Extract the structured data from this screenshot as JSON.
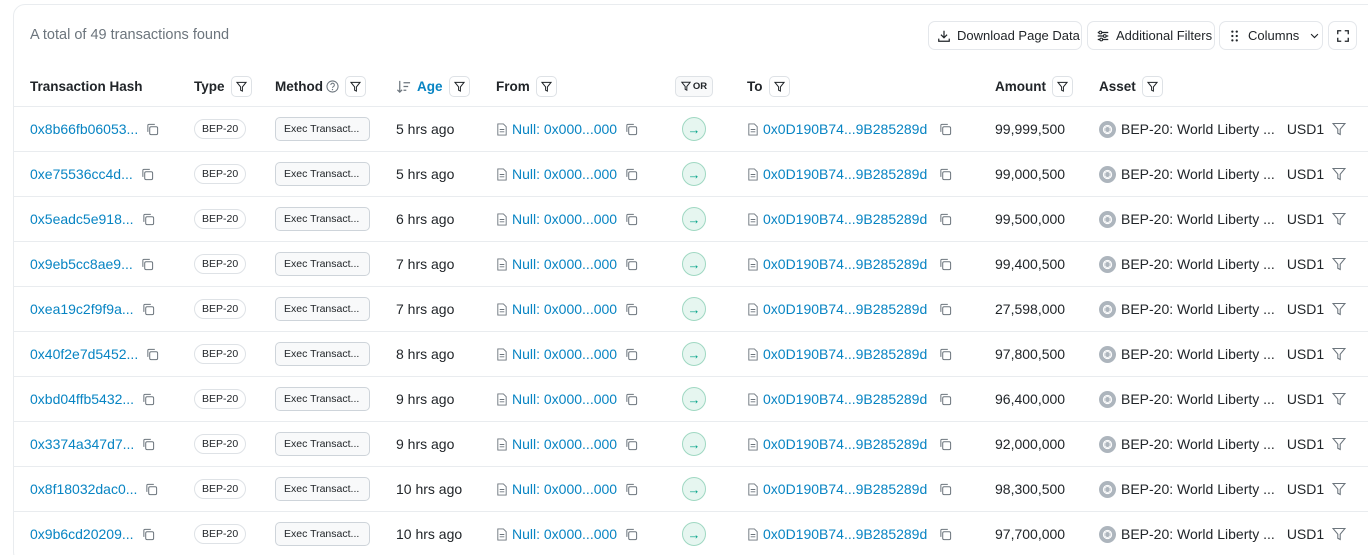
{
  "summary": {
    "total_text": "A total of 49 transactions found"
  },
  "toolbar": {
    "download_label": "Download Page Data",
    "filters_label": "Additional Filters",
    "columns_label": "Columns"
  },
  "columns": {
    "hash": "Transaction Hash",
    "type": "Type",
    "method": "Method",
    "age": "Age",
    "from": "From",
    "or": "OR",
    "to": "To",
    "amount": "Amount",
    "asset": "Asset"
  },
  "transactions": [
    {
      "hash": "0x8b66fb06053...",
      "type": "BEP-20",
      "method": "Exec Transact...",
      "age": "5 hrs ago",
      "from": "Null: 0x000...000",
      "to": "0x0D190B74...9B285289d",
      "amount": "99,999,500",
      "asset": "BEP-20: World Liberty ...",
      "symbol": "USD1"
    },
    {
      "hash": "0xe75536cc4d...",
      "type": "BEP-20",
      "method": "Exec Transact...",
      "age": "5 hrs ago",
      "from": "Null: 0x000...000",
      "to": "0x0D190B74...9B285289d",
      "amount": "99,000,500",
      "asset": "BEP-20: World Liberty ...",
      "symbol": "USD1"
    },
    {
      "hash": "0x5eadc5e918...",
      "type": "BEP-20",
      "method": "Exec Transact...",
      "age": "6 hrs ago",
      "from": "Null: 0x000...000",
      "to": "0x0D190B74...9B285289d",
      "amount": "99,500,000",
      "asset": "BEP-20: World Liberty ...",
      "symbol": "USD1"
    },
    {
      "hash": "0x9eb5cc8ae9...",
      "type": "BEP-20",
      "method": "Exec Transact...",
      "age": "7 hrs ago",
      "from": "Null: 0x000...000",
      "to": "0x0D190B74...9B285289d",
      "amount": "99,400,500",
      "asset": "BEP-20: World Liberty ...",
      "symbol": "USD1"
    },
    {
      "hash": "0xea19c2f9f9a...",
      "type": "BEP-20",
      "method": "Exec Transact...",
      "age": "7 hrs ago",
      "from": "Null: 0x000...000",
      "to": "0x0D190B74...9B285289d",
      "amount": "27,598,000",
      "asset": "BEP-20: World Liberty ...",
      "symbol": "USD1"
    },
    {
      "hash": "0x40f2e7d5452...",
      "type": "BEP-20",
      "method": "Exec Transact...",
      "age": "8 hrs ago",
      "from": "Null: 0x000...000",
      "to": "0x0D190B74...9B285289d",
      "amount": "97,800,500",
      "asset": "BEP-20: World Liberty ...",
      "symbol": "USD1"
    },
    {
      "hash": "0xbd04ffb5432...",
      "type": "BEP-20",
      "method": "Exec Transact...",
      "age": "9 hrs ago",
      "from": "Null: 0x000...000",
      "to": "0x0D190B74...9B285289d",
      "amount": "96,400,000",
      "asset": "BEP-20: World Liberty ...",
      "symbol": "USD1"
    },
    {
      "hash": "0x3374a347d7...",
      "type": "BEP-20",
      "method": "Exec Transact...",
      "age": "9 hrs ago",
      "from": "Null: 0x000...000",
      "to": "0x0D190B74...9B285289d",
      "amount": "92,000,000",
      "asset": "BEP-20: World Liberty ...",
      "symbol": "USD1"
    },
    {
      "hash": "0x8f18032dac0...",
      "type": "BEP-20",
      "method": "Exec Transact...",
      "age": "10 hrs ago",
      "from": "Null: 0x000...000",
      "to": "0x0D190B74...9B285289d",
      "amount": "98,300,500",
      "asset": "BEP-20: World Liberty ...",
      "symbol": "USD1"
    },
    {
      "hash": "0x9b6cd20209...",
      "type": "BEP-20",
      "method": "Exec Transact...",
      "age": "10 hrs ago",
      "from": "Null: 0x000...000",
      "to": "0x0D190B74...9B285289d",
      "amount": "97,700,000",
      "asset": "BEP-20: World Liberty ...",
      "symbol": "USD1"
    }
  ]
}
